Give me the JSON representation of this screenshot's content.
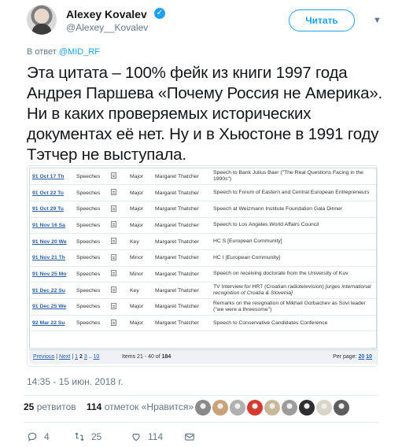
{
  "author": {
    "name": "Alexey Kovalev",
    "handle": "@Alexey__Kovalev",
    "follow_label": "Читать"
  },
  "reply": {
    "prefix": "В ответ",
    "mention": "@MID_RF"
  },
  "tweet_text": "Эта цитата – 100% фейк из книги 1997 года Андрея Паршева «Почему Россия не Америка». Ни в каких проверяемых исторических документах её нет. Ну и в Хьюстоне в 1991 году Тэтчер не выступала.",
  "embed": {
    "rows": [
      {
        "date": "91 Oct 17 Th",
        "type": "Speeches",
        "kind": "Major",
        "person": "Margaret Thatcher",
        "title": "Speech to Bank Julius Baer (\"The Real Questions Facing in the 1990s\")",
        "title_em": ""
      },
      {
        "date": "91 Oct 22 Tu",
        "type": "Speeches",
        "kind": "Major",
        "person": "Margaret Thatcher",
        "title": "Speech to Forum of Eastern and Central European Entrepreneurs",
        "title_em": ""
      },
      {
        "date": "91 Oct 29 Tu",
        "type": "Speeches",
        "kind": "Major",
        "person": "Margaret Thatcher",
        "title": "Speech at Weizmann Institute Foundation Gala Dinner",
        "title_em": ""
      },
      {
        "date": "91 Nov 16 Sa",
        "type": "Speeches",
        "kind": "Major",
        "person": "Margaret Thatcher",
        "title": "Speech to Los Angeles World Affairs Council",
        "title_em": ""
      },
      {
        "date": "91 Nov 20 We",
        "type": "Speeches",
        "kind": "Key",
        "person": "Margaret Thatcher",
        "title": "HC S [European Community]",
        "title_em": ""
      },
      {
        "date": "91 Nov 21 Th",
        "type": "Speeches",
        "kind": "Minor",
        "person": "Margaret Thatcher",
        "title": "HC I [European Community]",
        "title_em": ""
      },
      {
        "date": "91 Nov 25 Mo",
        "type": "Speeches",
        "kind": "Minor",
        "person": "Margaret Thatcher",
        "title": "Speech on receiving doctorate from the University of Kuv",
        "title_em": ""
      },
      {
        "date": "91 Dec 22 Su",
        "type": "Speeches",
        "kind": "Key",
        "person": "Margaret Thatcher",
        "title": "TV Interview for HRT (Croatian radiotelevision) ",
        "title_em": "[urges international recognition of Croatia & Slovenia]"
      },
      {
        "date": "91 Dec 25 We",
        "type": "Speeches",
        "kind": "Major",
        "person": "Margaret Thatcher",
        "title": "Remarks on the resignation of Mikhail Gorbachev as Sovi leader (\"we were a threesome\")",
        "title_em": ""
      },
      {
        "date": "92 Mar 22 Su",
        "type": "Speeches",
        "kind": "Major",
        "person": "Margaret Thatcher",
        "title": "Speech to Conservative Candidates Conference",
        "title_em": ""
      }
    ],
    "pager": {
      "previous": "Previous",
      "sep1": "|",
      "next": "Next",
      "sep2": "|",
      "p1": "1",
      "p2": "2",
      "p3": "3",
      "ellipsis": "..",
      "p10": "10",
      "items": "Items 21 - 40 of ",
      "items_total": "184",
      "per_page_label": "Per page:",
      "per_page_options": [
        "20",
        "10"
      ]
    }
  },
  "timestamp": "14:35 - 15 июн. 2018 г.",
  "stats": {
    "retweets_count": "25",
    "retweets_label": "ретвитов",
    "likes_count": "114",
    "likes_label": "отметок «Нравится»"
  },
  "likers_colors": [
    "#8a8a8a",
    "#c9a27a",
    "#b0b0b0",
    "#d43a2f",
    "#c8b89a",
    "#9c9c9c",
    "#2e2e2e",
    "#d9d4c8",
    "#5e5e5e"
  ],
  "actions": {
    "reply_count": "4",
    "retweet_count": "25",
    "like_count": "114"
  },
  "colors": {
    "accent": "#1da1f2",
    "muted": "#657786",
    "link": "#2a5ea8"
  }
}
